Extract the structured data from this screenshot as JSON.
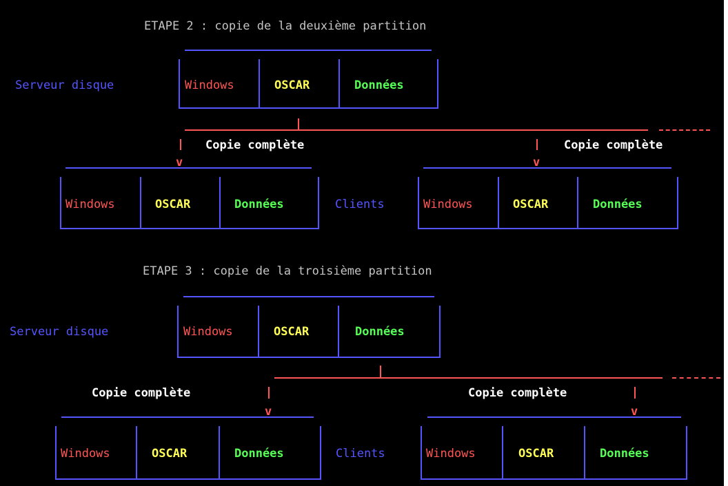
{
  "colors": {
    "background": "#000000",
    "title": "#c4c4c4",
    "label": "#5555ff",
    "windows": "#ff5555",
    "oscar": "#ffff55",
    "donnees": "#55ff55",
    "copy_text": "#ffffff"
  },
  "step2": {
    "title": "ETAPE 2 : copie de la deuxième partition",
    "server_label": "Serveur disque",
    "partitions": [
      "Windows",
      "OSCAR",
      "Données"
    ],
    "copy_left": "Copie complète",
    "copy_right": "Copie complète",
    "clients_label": "Clients",
    "client_left_partitions": [
      "Windows",
      "OSCAR",
      "Données"
    ],
    "client_right_partitions": [
      "Windows",
      "OSCAR",
      "Données"
    ]
  },
  "step3": {
    "title": "ETAPE 3 : copie de la troisième partition",
    "server_label": "Serveur disque",
    "partitions": [
      "Windows",
      "OSCAR",
      "Données"
    ],
    "copy_left": "Copie complète",
    "copy_right": "Copie complète",
    "clients_label": "Clients",
    "client_left_partitions": [
      "Windows",
      "OSCAR",
      "Données"
    ],
    "client_right_partitions": [
      "Windows",
      "OSCAR",
      "Données"
    ]
  }
}
